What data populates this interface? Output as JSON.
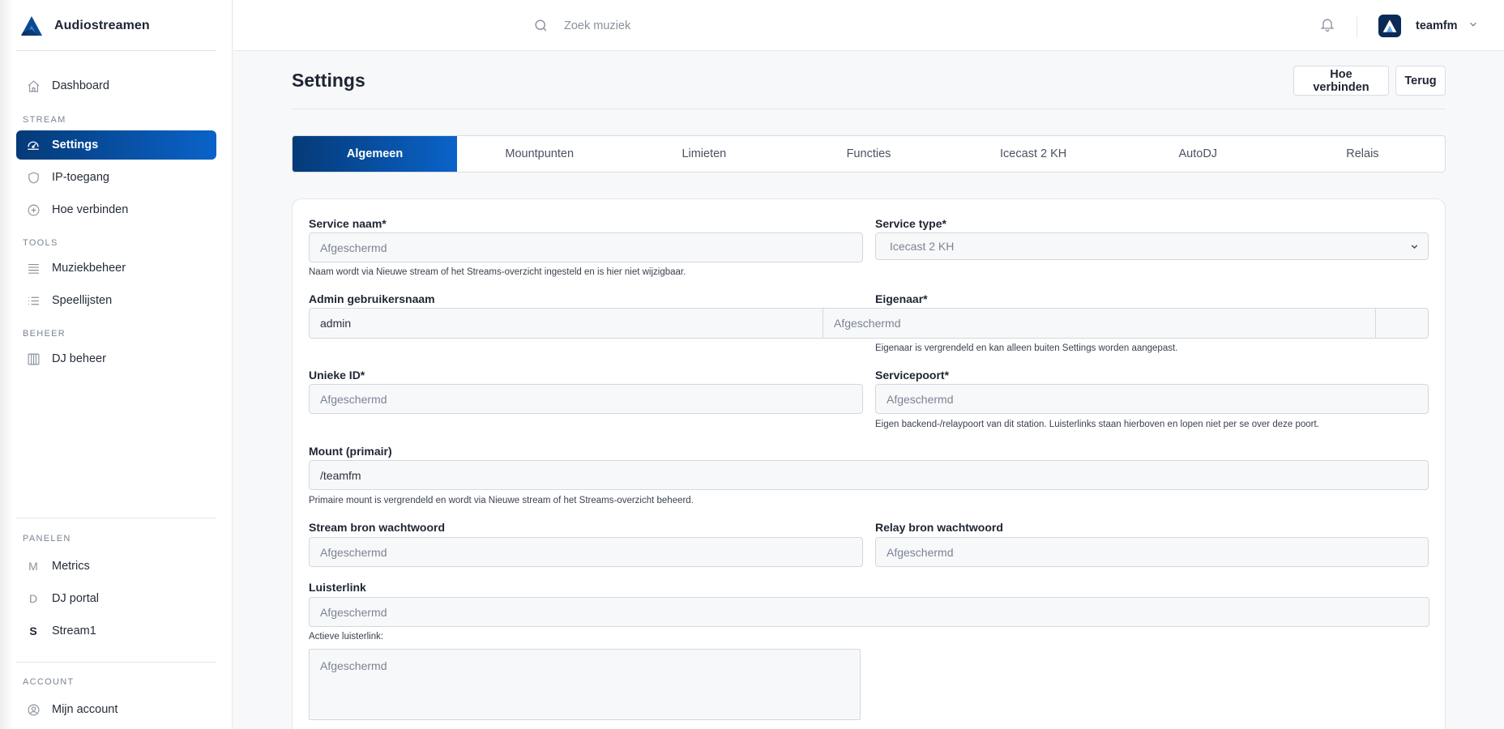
{
  "app": {
    "brand_name": "Audiostreamen"
  },
  "sidebar": {
    "dashboard": "Dashboard",
    "sections": {
      "stream": "STREAM",
      "tools": "TOOLS",
      "beheer": "BEHEER",
      "panelen": "PANELEN",
      "account": "ACCOUNT"
    },
    "stream_items": [
      "Settings",
      "IP-toegang",
      "Hoe verbinden"
    ],
    "tools_items": [
      "Muziekbeheer",
      "Speellijsten"
    ],
    "beheer_items": [
      "DJ beheer"
    ],
    "panelen_items": [
      {
        "letter": "M",
        "label": "Metrics"
      },
      {
        "letter": "D",
        "label": "DJ portal"
      },
      {
        "letter": "S",
        "label": "Stream1"
      }
    ],
    "account_items": [
      "Mijn account"
    ]
  },
  "topbar": {
    "search_placeholder": "Zoek muziek",
    "username": "teamfm"
  },
  "page": {
    "title": "Settings",
    "buttons": {
      "connect": "Hoe verbinden",
      "back": "Terug"
    },
    "tabs": [
      "Algemeen",
      "Mountpunten",
      "Limieten",
      "Functies",
      "Icecast 2 KH",
      "AutoDJ",
      "Relais"
    ],
    "active_tab": "Algemeen"
  },
  "form": {
    "service_name": {
      "label": "Service naam*",
      "placeholder": "Afgeschermd",
      "help": "Naam wordt via Nieuwe stream of het Streams-overzicht ingesteld en is hier niet wijzigbaar."
    },
    "service_type": {
      "label": "Service type*",
      "value": "Icecast 2 KH"
    },
    "admin_username": {
      "label": "Admin gebruikersnaam",
      "value": "admin"
    },
    "owner": {
      "label": "Eigenaar*",
      "placeholder": "Afgeschermd",
      "help": "Eigenaar is vergrendeld en kan alleen buiten Settings worden aangepast."
    },
    "unique_id": {
      "label": "Unieke ID*",
      "placeholder": "Afgeschermd"
    },
    "service_port": {
      "label": "Servicepoort*",
      "placeholder": "Afgeschermd",
      "help": "Eigen backend-/relaypoort van dit station. Luisterlinks staan hierboven en lopen niet per se over deze poort."
    },
    "mount": {
      "label": "Mount (primair)",
      "value": "/teamfm",
      "help": "Primaire mount is vergrendeld en wordt via Nieuwe stream of het Streams-overzicht beheerd."
    },
    "stream_source_password": {
      "label": "Stream bron wachtwoord",
      "placeholder": "Afgeschermd"
    },
    "relay_source_password": {
      "label": "Relay bron wachtwoord",
      "placeholder": "Afgeschermd"
    },
    "listen_link": {
      "label": "Luisterlink",
      "placeholder": "Afgeschermd",
      "help": "Actieve luisterlink:",
      "textarea_placeholder": "Afgeschermd"
    }
  }
}
